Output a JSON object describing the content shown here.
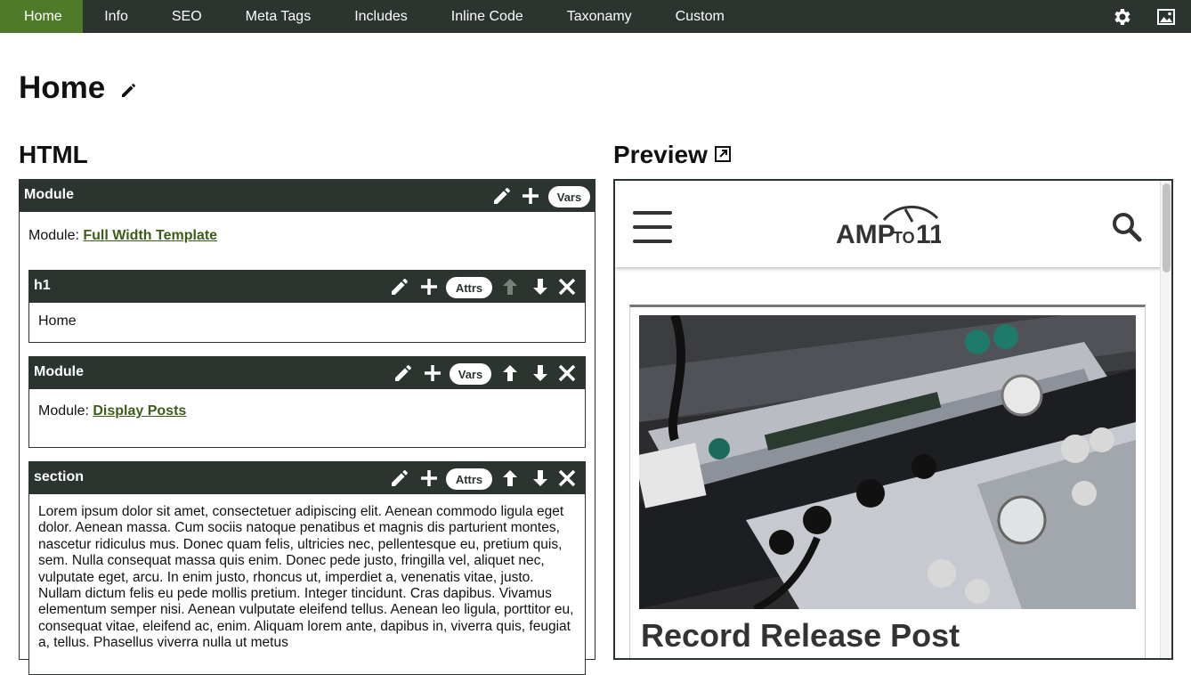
{
  "nav": {
    "tabs": [
      "Home",
      "Info",
      "SEO",
      "Meta Tags",
      "Includes",
      "Inline Code",
      "Taxonamy",
      "Custom"
    ],
    "active": "Home",
    "right_icons": [
      "gear-icon",
      "image-icon"
    ]
  },
  "page": {
    "title": "Home"
  },
  "html_panel": {
    "heading": "HTML",
    "module_block": {
      "title": "Module",
      "vars_label": "Vars",
      "module_prefix": "Module:",
      "module_link": "Full Width Template"
    },
    "h1_block": {
      "title": "h1",
      "attrs_label": "Attrs",
      "content": "Home"
    },
    "posts_block": {
      "title": "Module",
      "vars_label": "Vars",
      "module_prefix": "Module:",
      "module_link": "Display Posts"
    },
    "section_block": {
      "title": "section",
      "attrs_label": "Attrs",
      "text": "Lorem ipsum dolor sit amet, consectetuer adipiscing elit. Aenean commodo ligula eget dolor. Aenean massa. Cum sociis natoque penatibus et magnis dis parturient montes, nascetur ridiculus mus. Donec quam felis, ultricies nec, pellentesque eu, pretium quis, sem. Nulla consequat massa quis enim. Donec pede justo, fringilla vel, aliquet nec, vulputate eget, arcu. In enim justo, rhoncus ut, imperdiet a, venenatis vitae, justo. Nullam dictum felis eu pede mollis pretium. Integer tincidunt. Cras dapibus. Vivamus elementum semper nisi. Aenean vulputate eleifend tellus. Aenean leo ligula, porttitor eu, consequat vitae, eleifend ac, enim. Aliquam lorem ante, dapibus in, viverra quis, feugiat a, tellus. Phasellus viverra nulla ut metus"
    }
  },
  "preview_panel": {
    "heading": "Preview",
    "logo": {
      "main": "AMP",
      "small": "TO",
      "num": "11"
    },
    "card_title": "Record Release Post"
  },
  "colors": {
    "navbar": "#2b342e",
    "active_tab": "#4f7a28",
    "link": "#3d5c18"
  }
}
